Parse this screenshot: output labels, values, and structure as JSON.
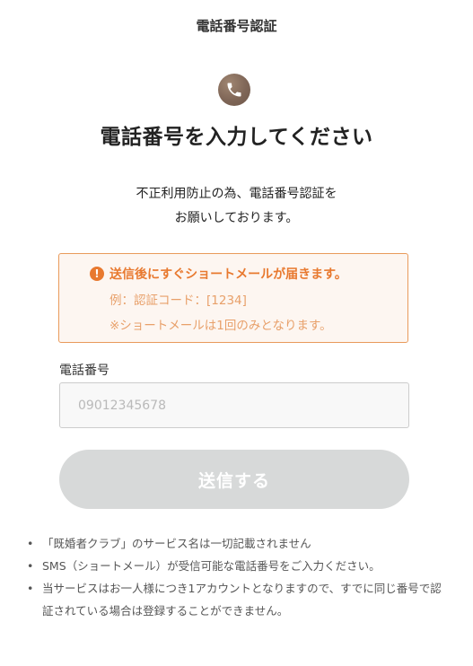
{
  "header": {
    "title": "電話番号認証"
  },
  "icons": {
    "phone": "phone-icon",
    "warning": "exclamation-circle-icon"
  },
  "main": {
    "heading": "電話番号を入力してください",
    "intro_line1": "不正利用防止の為、電話番号認証を",
    "intro_line2": "お願いしております。"
  },
  "notice": {
    "title": "送信後にすぐショートメールが届きます。",
    "line1": "例：認証コード：[1234]",
    "line2": "※ショートメールは1回のみとなります。",
    "colors": {
      "border": "#e99a5b",
      "background": "#fdf6f1",
      "title": "#e8792f",
      "text": "#e8a06a"
    }
  },
  "form": {
    "phone_label": "電話番号",
    "phone_value": "",
    "phone_placeholder": "09012345678",
    "submit_label": "送信する",
    "submit_color": "#d7d9d9"
  },
  "notes": [
    "「既婚者クラブ」のサービス名は一切記載されません",
    "SMS（ショートメール）が受信可能な電話番号をご入力ください。",
    "当サービスはお一人様につき1アカウントとなりますので、すでに同じ番号で認証されている場合は登録することができません。"
  ]
}
